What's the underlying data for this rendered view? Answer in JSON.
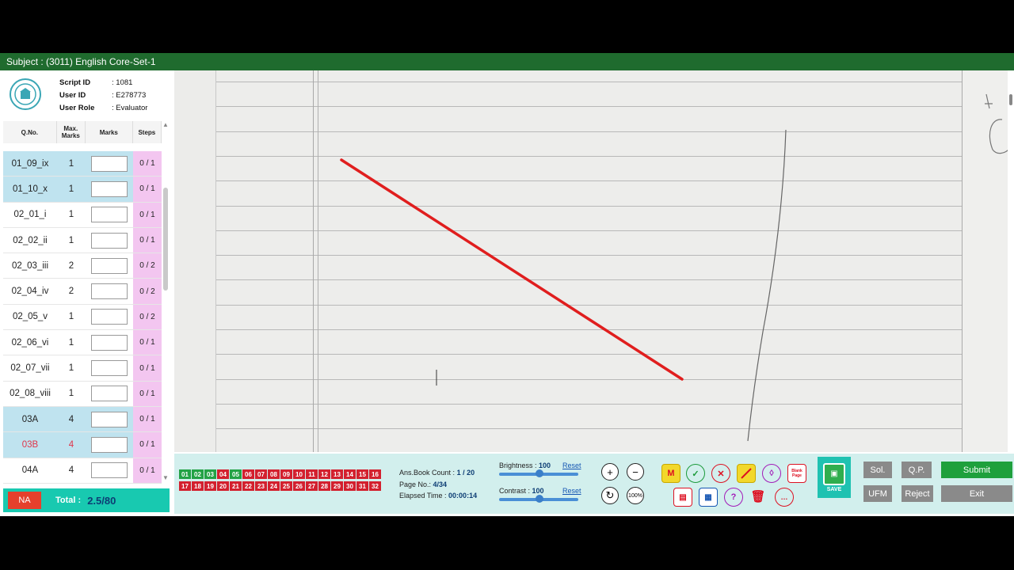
{
  "subject": "Subject : (3011) English Core-Set-1",
  "info": [
    {
      "label": "Script ID",
      "value": ":  1081"
    },
    {
      "label": "User ID",
      "value": ":  E278773"
    },
    {
      "label": "User Role",
      "value": ":  Evaluator"
    }
  ],
  "table": {
    "headers": [
      "Q.No.",
      "Max. Marks",
      "Marks",
      "Steps"
    ],
    "rows": [
      {
        "q": "01_09_ix",
        "max": "1",
        "steps": "0 / 1",
        "hl": true
      },
      {
        "q": "01_10_x",
        "max": "1",
        "steps": "0 / 1",
        "hl": true
      },
      {
        "q": "02_01_i",
        "max": "1",
        "steps": "0 / 1"
      },
      {
        "q": "02_02_ii",
        "max": "1",
        "steps": "0 / 1"
      },
      {
        "q": "02_03_iii",
        "max": "2",
        "steps": "0 / 2"
      },
      {
        "q": "02_04_iv",
        "max": "2",
        "steps": "0 / 2"
      },
      {
        "q": "02_05_v",
        "max": "1",
        "steps": "0 / 2"
      },
      {
        "q": "02_06_vi",
        "max": "1",
        "steps": "0 / 1"
      },
      {
        "q": "02_07_vii",
        "max": "1",
        "steps": "0 / 1"
      },
      {
        "q": "02_08_viii",
        "max": "1",
        "steps": "0 / 1"
      },
      {
        "q": "03A",
        "max": "4",
        "steps": "0 / 1",
        "hl": true
      },
      {
        "q": "03B",
        "max": "4",
        "steps": "0 / 1",
        "hl": true,
        "red": true
      },
      {
        "q": "04A",
        "max": "4",
        "steps": "0 / 1"
      }
    ]
  },
  "na_label": "NA",
  "total_label": "Total :",
  "total_value": "2.5/80",
  "pages_row1": [
    "01",
    "02",
    "03",
    "04",
    "05",
    "06",
    "07",
    "08",
    "09",
    "10",
    "11",
    "12",
    "13",
    "14",
    "15",
    "16"
  ],
  "pages_row2": [
    "17",
    "18",
    "19",
    "20",
    "21",
    "22",
    "23",
    "24",
    "25",
    "26",
    "27",
    "28",
    "29",
    "30",
    "31",
    "32"
  ],
  "green_pages": [
    "01",
    "02",
    "03",
    "05"
  ],
  "stats": {
    "ansbook_label": "Ans.Book Count :",
    "ansbook_value": "1 / 20",
    "page_label": "Page No.:",
    "page_value": "4/34",
    "elapsed_label": "Elapsed Time :",
    "elapsed_value": "00:00:14"
  },
  "brightness": {
    "label": "Brightness :",
    "value": "100",
    "reset": "Reset",
    "level": 0.46
  },
  "contrast": {
    "label": "Contrast :",
    "value": "100",
    "reset": "Reset",
    "level": 0.46
  },
  "tool_icons": {
    "m": "M",
    "blank_page": "Blank Page",
    "save": "SAVE"
  },
  "buttons": {
    "sol": "Sol.",
    "qp": "Q.P.",
    "submit": "Submit",
    "ufm": "UFM",
    "reject": "Reject",
    "exit": "Exit"
  },
  "colors": {
    "accent": "#1fc2b1",
    "header_green": "#1f6b2e",
    "mark_red": "#e01e1e"
  }
}
